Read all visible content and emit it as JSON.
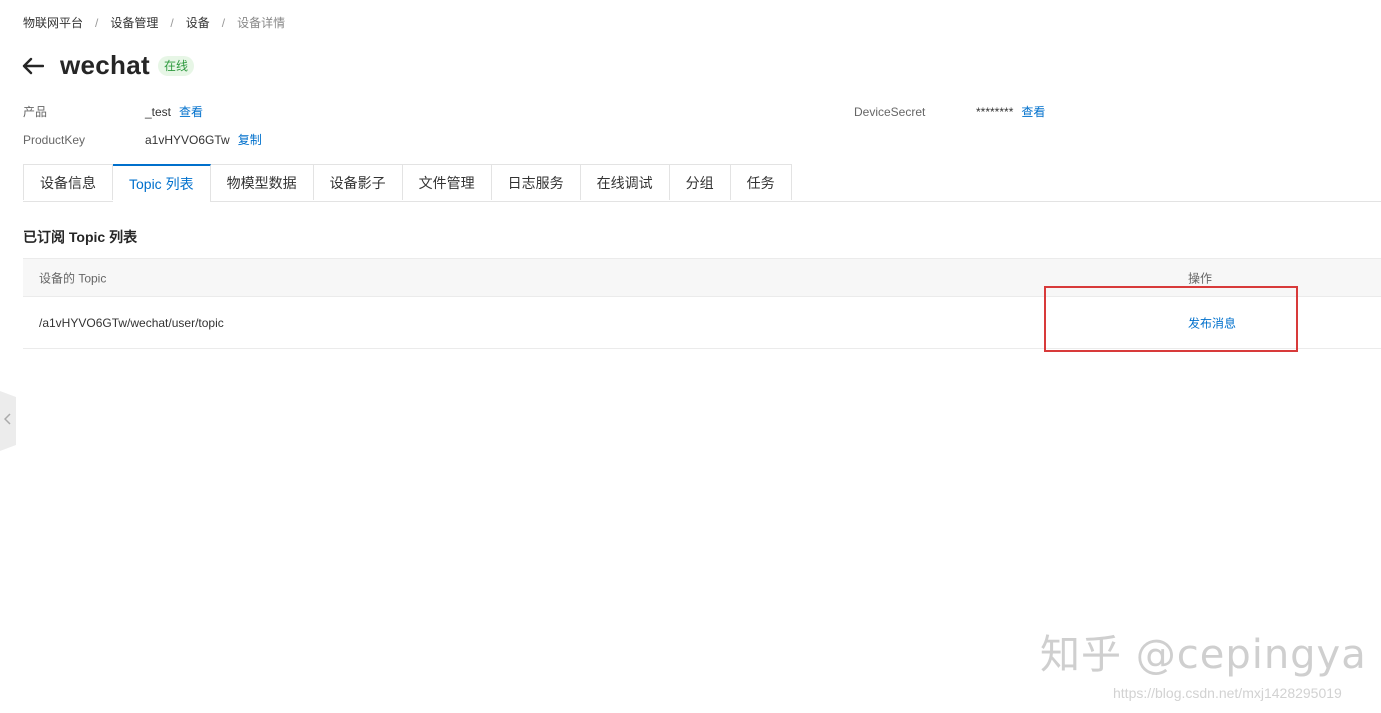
{
  "breadcrumb": {
    "items": [
      "物联网平台",
      "设备管理",
      "设备"
    ],
    "current": "设备详情",
    "separator": "/"
  },
  "device": {
    "name": "wechat",
    "status": "在线"
  },
  "meta": {
    "product_label": "产品",
    "product_value": "_test",
    "product_link": "查看",
    "productkey_label": "ProductKey",
    "productkey_value": "a1vHYVO6GTw",
    "productkey_link": "复制",
    "secret_label": "DeviceSecret",
    "secret_value": "********",
    "secret_link": "查看"
  },
  "tabs": [
    {
      "label": "设备信息",
      "active": false
    },
    {
      "label": "Topic 列表",
      "active": true
    },
    {
      "label": "物模型数据",
      "active": false
    },
    {
      "label": "设备影子",
      "active": false
    },
    {
      "label": "文件管理",
      "active": false
    },
    {
      "label": "日志服务",
      "active": false
    },
    {
      "label": "在线调试",
      "active": false
    },
    {
      "label": "分组",
      "active": false
    },
    {
      "label": "任务",
      "active": false
    }
  ],
  "section": {
    "title": "已订阅 Topic 列表"
  },
  "table": {
    "headers": [
      "设备的 Topic",
      "操作"
    ],
    "rows": [
      {
        "topic": "/a1vHYVO6GTw/wechat/user/topic",
        "action": "发布消息"
      }
    ]
  },
  "watermark": {
    "text": "知乎 @cepingya",
    "url": "https://blog.csdn.net/mxj1428295019"
  },
  "colors": {
    "accent": "#0070cc",
    "status_bg": "#e7f6e6",
    "status_text": "#2f9a3f",
    "highlight": "#d83a3a"
  }
}
